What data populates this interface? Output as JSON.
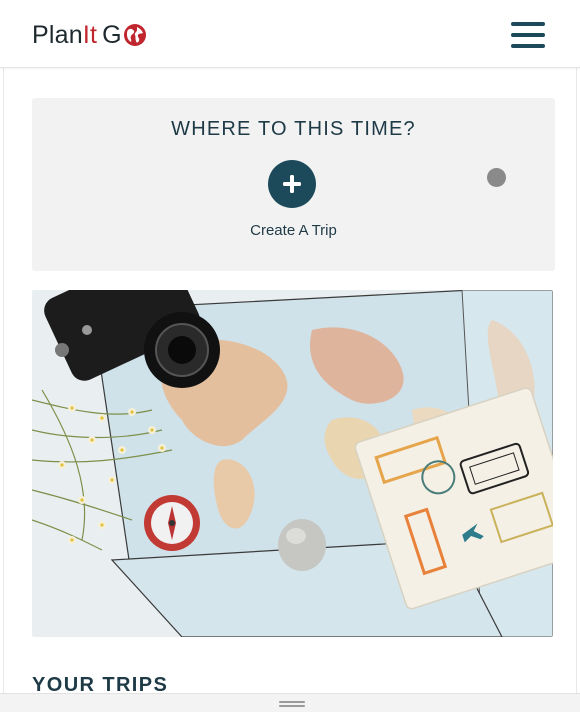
{
  "navbar": {
    "brand_part1": "Plan",
    "brand_part2": "It",
    "brand_part3": "G",
    "brand_colors": {
      "dark": "#1e2a30",
      "accent": "#c0262d"
    },
    "logo_icon": "globe-icon",
    "menu_icon": "hamburger-menu-icon"
  },
  "hero": {
    "title": "WHERE TO THIS TIME?",
    "add_button_icon": "plus-icon",
    "add_button_label": "Create A Trip",
    "accent_color": "#1d4a5a"
  },
  "photo": {
    "description_icon": "travel-flatlay-photo"
  },
  "trips": {
    "section_title": "YOUR TRIPS"
  }
}
